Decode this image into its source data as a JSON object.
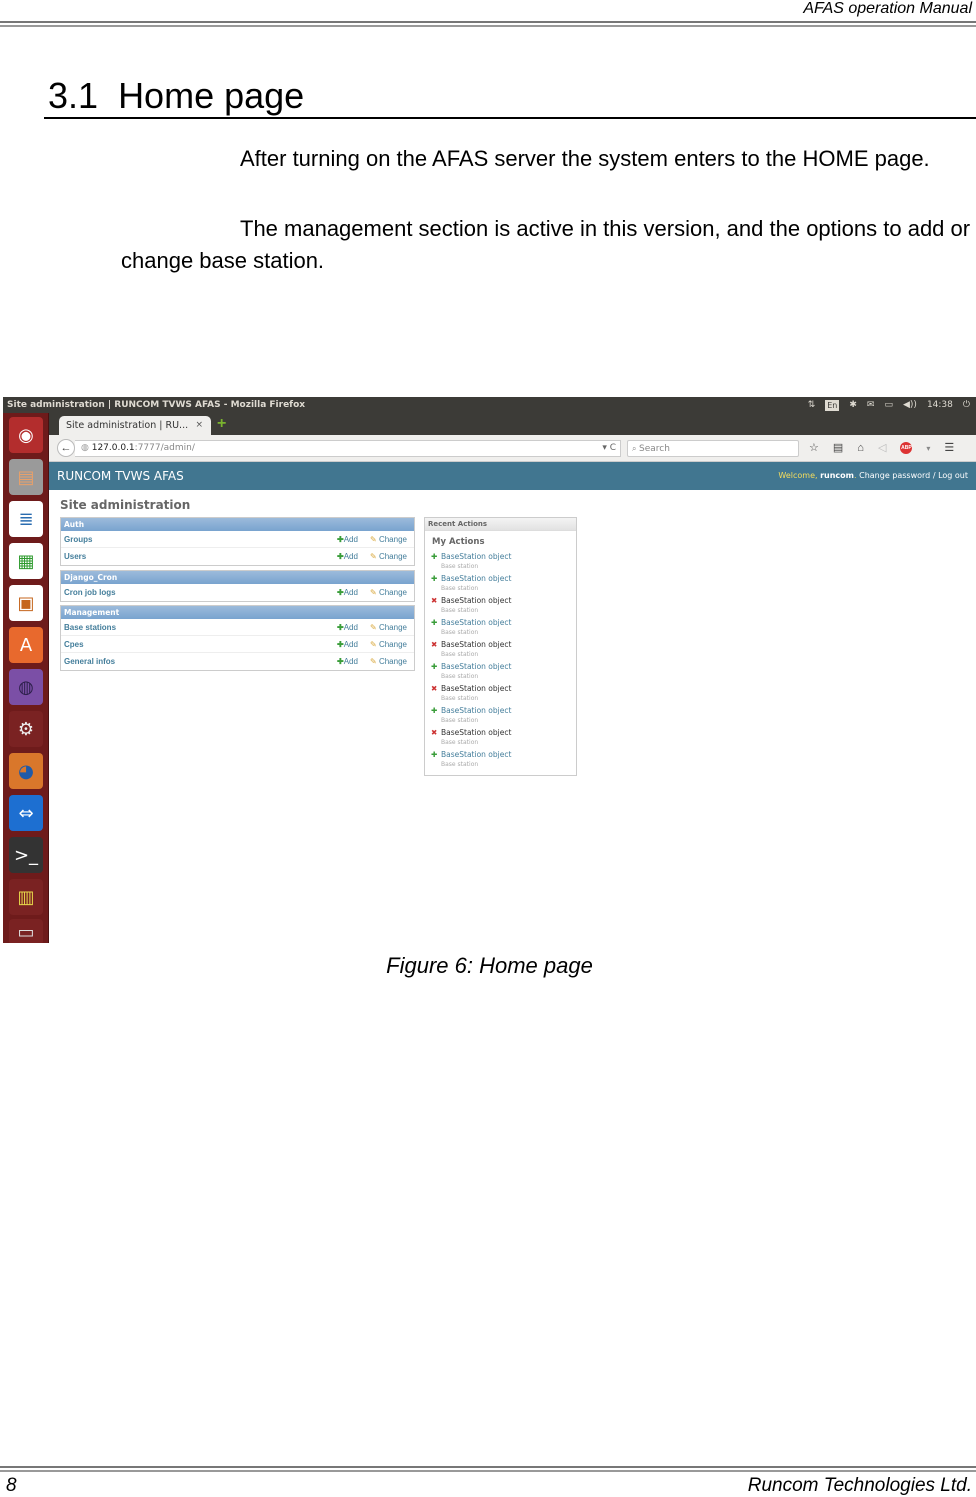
{
  "doc_header": {
    "title": "AFAS operation Manual"
  },
  "section": {
    "number": "3.1",
    "title": "Home page"
  },
  "paragraphs": [
    "After turning on the AFAS server the system enters to the HOME page.",
    "The management section is active in this version, and the options to add or change base station."
  ],
  "screenshot": {
    "window_title": "Site administration | RUNCOM TVWS AFAS - Mozilla Firefox",
    "tray": {
      "network": "⇅",
      "keyboard": "En",
      "bluetooth": "✱",
      "mail": "✉",
      "battery": "▭",
      "volume": "◀))",
      "clock": "14:38",
      "power": "⏻"
    },
    "launcher_icons": [
      {
        "name": "ubuntu-dash",
        "glyph": "◉",
        "bg": "#b32d2d",
        "fg": "#ffffff"
      },
      {
        "name": "files",
        "glyph": "▤",
        "bg": "#9a9a9a",
        "fg": "#e8a06a"
      },
      {
        "name": "libreoffice-writer",
        "glyph": "≣",
        "bg": "#ffffff",
        "fg": "#2a6cb0"
      },
      {
        "name": "libreoffice-calc",
        "glyph": "▦",
        "bg": "#ffffff",
        "fg": "#2e9a2e"
      },
      {
        "name": "libreoffice-impress",
        "glyph": "▣",
        "bg": "#ffffff",
        "fg": "#c5661e"
      },
      {
        "name": "software-center",
        "glyph": "A",
        "bg": "#e8692d",
        "fg": "#ffffff"
      },
      {
        "name": "eclipse",
        "glyph": "◍",
        "bg": "#7b4fa6",
        "fg": "#2c1f4a"
      },
      {
        "name": "system-settings",
        "glyph": "⚙",
        "bg": "#7a2222",
        "fg": "#eeeeee"
      },
      {
        "name": "firefox",
        "glyph": "◕",
        "bg": "#d9772b",
        "fg": "#1f5aa8"
      },
      {
        "name": "teamviewer",
        "glyph": "⇔",
        "bg": "#1d6fd1",
        "fg": "#ffffff"
      },
      {
        "name": "terminal",
        "glyph": ">_",
        "bg": "#333333",
        "fg": "#ffffff"
      },
      {
        "name": "sd-card-writer",
        "glyph": "▥",
        "bg": "#7a2222",
        "fg": "#e8d84a"
      },
      {
        "name": "trash",
        "glyph": "▭",
        "bg": "#7a2222",
        "fg": "#dddddd"
      }
    ],
    "tab": {
      "label": "Site administration | RU...",
      "close": "×",
      "new_tab": "+"
    },
    "nav": {
      "back": "←",
      "url_host": "127.0.0.1",
      "url_rest": ":7777/admin/",
      "url_right": "▾ C",
      "search_placeholder": "Search",
      "search_icon": "🔍",
      "icons": [
        "☆",
        "▤",
        "⌂",
        "◁"
      ],
      "abp_label": "ABP",
      "menu": "☰"
    },
    "django": {
      "brand": "RUNCOM TVWS AFAS",
      "welcome": "Welcome,",
      "user": "runcom",
      "change_password": "Change password",
      "separator": "/",
      "logout": "Log out",
      "site_title": "Site administration",
      "modules": [
        {
          "title": "Auth",
          "rows": [
            {
              "name": "Groups"
            },
            {
              "name": "Users"
            }
          ]
        },
        {
          "title": "Django_Cron",
          "rows": [
            {
              "name": "Cron job logs"
            }
          ]
        },
        {
          "title": "Management",
          "rows": [
            {
              "name": "Base stations"
            },
            {
              "name": "Cpes"
            },
            {
              "name": "General infos"
            }
          ]
        }
      ],
      "add_label": "Add",
      "change_label": "Change",
      "recent": {
        "title": "Recent Actions",
        "subtitle": "My Actions",
        "items": [
          {
            "action": "add",
            "title": "BaseStation object",
            "type": "Base station"
          },
          {
            "action": "add",
            "title": "BaseStation object",
            "type": "Base station"
          },
          {
            "action": "delete",
            "title": "BaseStation object",
            "type": "Base station"
          },
          {
            "action": "add",
            "title": "BaseStation object",
            "type": "Base station"
          },
          {
            "action": "delete",
            "title": "BaseStation object",
            "type": "Base station"
          },
          {
            "action": "add",
            "title": "BaseStation object",
            "type": "Base station"
          },
          {
            "action": "delete",
            "title": "BaseStation object",
            "type": "Base station"
          },
          {
            "action": "add",
            "title": "BaseStation object",
            "type": "Base station"
          },
          {
            "action": "delete",
            "title": "BaseStation object",
            "type": "Base station"
          },
          {
            "action": "add",
            "title": "BaseStation object",
            "type": "Base station"
          }
        ]
      }
    }
  },
  "caption": "Figure 6: Home page",
  "footer": {
    "page_number": "8",
    "company": "Runcom Technologies Ltd."
  },
  "colors": {
    "django_header": "#417690",
    "module_header": "#79a3cf",
    "link": "#447e9b",
    "launcher": "#6e1b1b"
  }
}
